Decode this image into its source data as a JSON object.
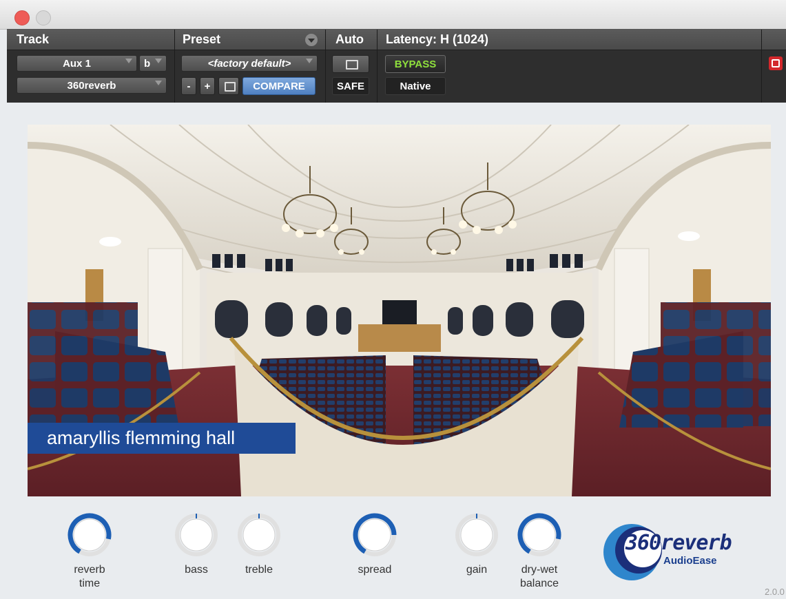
{
  "header": {
    "track_label": "Track",
    "preset_label": "Preset",
    "auto_label": "Auto",
    "latency_label": "Latency: H (1024)",
    "track_select": "Aux 1",
    "track_suffix": "b",
    "plugin_select": "360reverb",
    "preset_select": "<factory default>",
    "minus": "-",
    "plus": "+",
    "compare": "COMPARE",
    "safe": "SAFE",
    "bypass": "BYPASS",
    "native": "Native"
  },
  "room": {
    "name": "amaryllis flemming hall"
  },
  "knobs": [
    {
      "label": "reverb\ntime",
      "level": 0.8
    },
    {
      "label": "bass",
      "level": 0.0
    },
    {
      "label": "treble",
      "level": 0.0
    },
    {
      "label": "spread",
      "level": 0.75
    },
    {
      "label": "gain",
      "level": 0.0
    },
    {
      "label": "dry-wet\nbalance",
      "level": 0.8
    }
  ],
  "logo": {
    "name": "360reverb",
    "brand": "AudioEase"
  },
  "version": "2.0.0",
  "colors": {
    "accent": "#1f4b97",
    "knob_blue": "#1d5fb4",
    "bypass_green": "#8fe03c"
  }
}
